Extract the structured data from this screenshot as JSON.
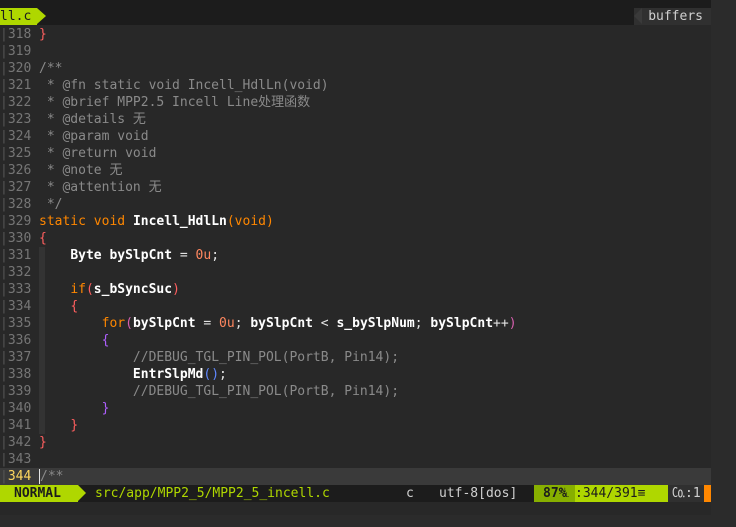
{
  "tabline": {
    "active_tab": "ll.c",
    "right_label": "buffers"
  },
  "lines": [
    {
      "n": "318",
      "html": "<span class='c-brace1'>}</span>"
    },
    {
      "n": "319",
      "html": ""
    },
    {
      "n": "320",
      "html": "<span class='c-com'>/**</span>"
    },
    {
      "n": "321",
      "html": "<span class='c-com'> * @fn static void Incell_HdlLn(void)</span>"
    },
    {
      "n": "322",
      "html": "<span class='c-com'> * @brief MPP2.5 Incell Line处理函数</span>"
    },
    {
      "n": "323",
      "html": "<span class='c-com'> * @details 无</span>"
    },
    {
      "n": "324",
      "html": "<span class='c-com'> * @param void</span>"
    },
    {
      "n": "325",
      "html": "<span class='c-com'> * @return void</span>"
    },
    {
      "n": "326",
      "html": "<span class='c-com'> * @note 无</span>"
    },
    {
      "n": "327",
      "html": "<span class='c-com'> * @attention 无</span>"
    },
    {
      "n": "328",
      "html": "<span class='c-com'> */</span>"
    },
    {
      "n": "329",
      "html": "<span class='c-kw'>static</span> <span class='c-kw'>void</span> <span class='c-bold'>Incell_HdlLn</span><span class='c-kw'>(void)</span>"
    },
    {
      "n": "330",
      "html": "<span class='c-brace1'>{</span>"
    },
    {
      "n": "331",
      "html": "    <span class='c-bold'>Byte bySlpCnt</span> = <span class='c-num'>0u</span>;"
    },
    {
      "n": "332",
      "html": ""
    },
    {
      "n": "333",
      "html": "    <span class='c-kw'>if</span><span class='c-brace1'>(</span><span class='c-bold'>s_bSyncSuc</span><span class='c-brace1'>)</span>"
    },
    {
      "n": "334",
      "html": "    <span class='c-brace1'>{</span>"
    },
    {
      "n": "335",
      "html": "        <span class='c-kw'>for</span><span class='c-brace2'>(</span><span class='c-bold'>bySlpCnt</span> = <span class='c-num'>0u</span>; <span class='c-bold'>bySlpCnt</span> &lt; <span class='c-bold'>s_bySlpNum</span>; <span class='c-bold'>bySlpCnt</span>++<span class='c-brace2'>)</span>"
    },
    {
      "n": "336",
      "html": "        <span class='c-brace3'>{</span>"
    },
    {
      "n": "337",
      "html": "            <span class='c-com'>//DEBUG_TGL_PIN_POL(PortB, Pin14);</span>"
    },
    {
      "n": "338",
      "html": "            <span class='c-bold'>EntrSlpMd</span><span class='c-paren3'>()</span>;"
    },
    {
      "n": "339",
      "html": "            <span class='c-com'>//DEBUG_TGL_PIN_POL(PortB, Pin14);</span>"
    },
    {
      "n": "340",
      "html": "        <span class='c-brace3'>}</span>"
    },
    {
      "n": "341",
      "html": "    <span class='c-brace1'>}</span>"
    },
    {
      "n": "342",
      "html": "<span class='c-brace1'>}</span>"
    },
    {
      "n": "343",
      "html": ""
    },
    {
      "n": "344",
      "html": "<span class='c-com'>/**</span>",
      "current": true
    }
  ],
  "status": {
    "mode": "NORMAL",
    "file": "src/app/MPP2_5/MPP2_5_incell.c",
    "filetype": "c",
    "encoding": "utf-8[dos]",
    "percent": "87%",
    "line_icon": "␤",
    "position": ":344/391≡",
    "col": "㏇:1"
  },
  "colors": {
    "accent": "#afd700",
    "background": "#282828",
    "keyword": "#ff8700"
  }
}
